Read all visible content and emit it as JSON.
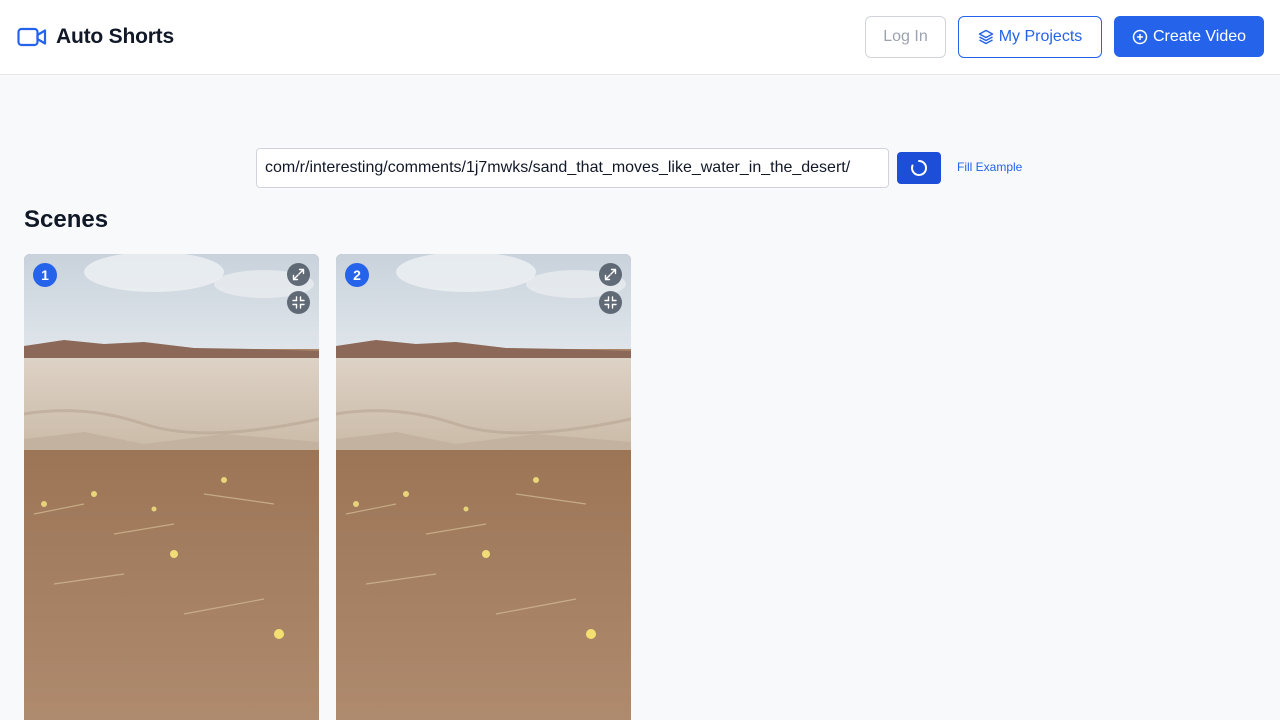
{
  "header": {
    "app_name": "Auto Shorts",
    "login_label": "Log In",
    "projects_label": "My Projects",
    "create_label": "Create Video",
    "accent_color": "#2563eb"
  },
  "form": {
    "url_value": "com/r/interesting/comments/1j7mwks/sand_that_moves_like_water_in_the_desert/",
    "fill_example_label": "Fill Example"
  },
  "scenes": {
    "title": "Scenes",
    "items": [
      {
        "number": "1"
      },
      {
        "number": "2"
      }
    ]
  },
  "icons": {
    "logo": "video-camera-icon",
    "projects": "layers-icon",
    "create": "plus-circle-icon",
    "reload": "loading-spinner-icon",
    "expand": "expand-icon",
    "shrink": "shrink-icon"
  }
}
